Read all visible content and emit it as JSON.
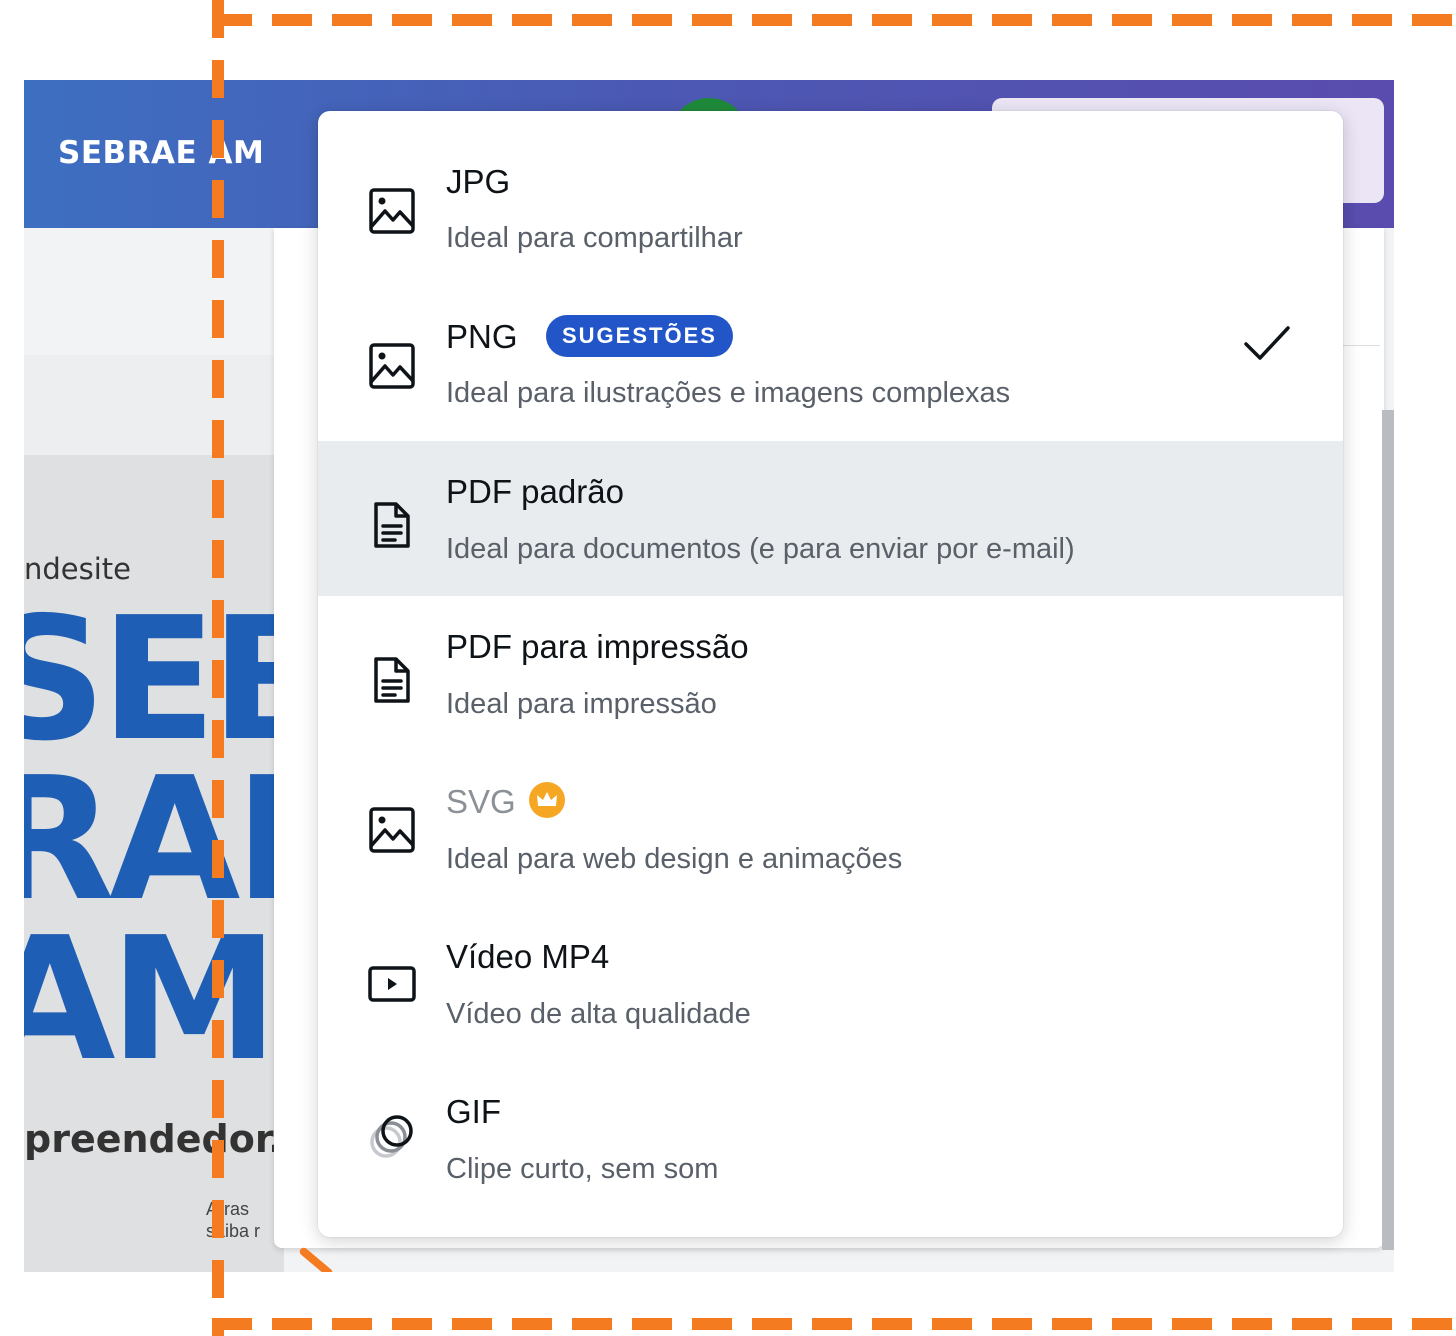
{
  "app": {
    "brand_text": "SEBRAE AM",
    "design": {
      "small_text": "ndesite",
      "big_lines": [
        "SEB",
        "RAE",
        "AM"
      ],
      "sub_text": "preendedor.",
      "caption_lines": [
        "Arras",
        "saiba r"
      ]
    }
  },
  "menu": {
    "items": [
      {
        "title": "JPG",
        "description": "Ideal para compartilhar",
        "icon": "image-icon"
      },
      {
        "title": "PNG",
        "badge": "SUGESTÕES",
        "description": "Ideal para ilustrações e imagens complexas",
        "icon": "image-icon",
        "selected": true
      },
      {
        "title": "PDF padrão",
        "description": "Ideal para documentos (e para enviar por e-mail)",
        "icon": "document-icon"
      },
      {
        "title": "PDF para impressão",
        "description": "Ideal para impressão",
        "icon": "document-icon"
      },
      {
        "title": "SVG",
        "description": "Ideal para web design e animações",
        "icon": "image-icon",
        "premium_icon": "crown-icon"
      },
      {
        "title": "Vídeo MP4",
        "description": "Vídeo de alta qualidade",
        "icon": "video-play-icon"
      },
      {
        "title": "GIF",
        "description": "Clipe curto, sem som",
        "icon": "gif-circles-icon"
      }
    ]
  },
  "colors": {
    "accent_orange": "#f47b20",
    "badge_blue": "#2256c8",
    "crown_gold": "#f5a623",
    "brand_blue": "#1e5eb4"
  }
}
